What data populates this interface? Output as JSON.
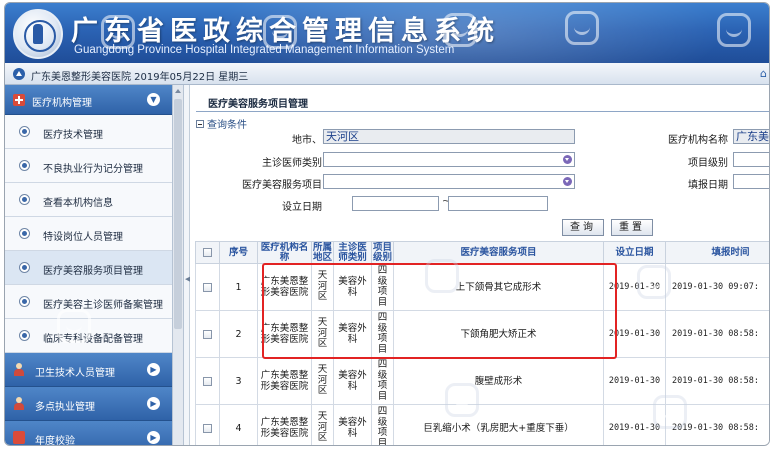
{
  "header": {
    "title": "广东省医政综合管理信息系统",
    "subtitle": "Guangdong Province Hospital Integrated Management Information System"
  },
  "infobar": {
    "text": "广东美恩整形美容医院 2019年05月22日 星期三"
  },
  "sidebar": {
    "section_label": "医疗机构管理",
    "items": [
      {
        "label": "医疗技术管理"
      },
      {
        "label": "不良执业行为记分管理"
      },
      {
        "label": "查看本机构信息"
      },
      {
        "label": "特设岗位人员管理"
      },
      {
        "label": "医疗美容服务项目管理"
      },
      {
        "label": "医疗美容主诊医师备案管理"
      },
      {
        "label": "临床专科设备配备管理"
      }
    ],
    "categories": [
      {
        "label": "卫生技术人员管理"
      },
      {
        "label": "多点执业管理"
      },
      {
        "label": "年度校验"
      }
    ]
  },
  "main": {
    "page_title": "医疗美容服务项目管理",
    "query_toggle": "查询条件",
    "form": {
      "city_label": "地市、区（县）",
      "city_value": "天河区",
      "org_label": "医疗机构名称",
      "org_value": "广东美",
      "doctor_type_label": "主诊医师类别",
      "doctor_type_value": "",
      "level_label": "项目级别",
      "service_label": "医疗美容服务项目",
      "service_value": "",
      "fill_date_label": "填报日期",
      "setup_date_label": "设立日期",
      "date_sep": "~",
      "search_button": "查询",
      "reset_button": "重置"
    },
    "table": {
      "headers": [
        "序号",
        "医疗机构名称",
        "所属地区",
        "主诊医师类别",
        "项目级别",
        "医疗美容服务项目",
        "设立日期",
        "填报时间"
      ],
      "rows": [
        {
          "no": "1",
          "org": "广东美恩整形美容医院",
          "region": "天河区",
          "doctor_type": "美容外科",
          "level": "四级项目",
          "service": "上下颌骨其它成形术",
          "setup_date": "2019-01-30",
          "fill_time": "2019-01-30 09:07:"
        },
        {
          "no": "2",
          "org": "广东美恩整形美容医院",
          "region": "天河区",
          "doctor_type": "美容外科",
          "level": "四级项目",
          "service": "下颌角肥大矫正术",
          "setup_date": "2019-01-30",
          "fill_time": "2019-01-30 08:58:"
        },
        {
          "no": "3",
          "org": "广东美恩整形美容医院",
          "region": "天河区",
          "doctor_type": "美容外科",
          "level": "四级项目",
          "service": "腹壁成形术",
          "setup_date": "2019-01-30",
          "fill_time": "2019-01-30 08:58:"
        },
        {
          "no": "4",
          "org": "广东美恩整形美容医院",
          "region": "天河区",
          "doctor_type": "美容外科",
          "level": "四级项目",
          "service": "巨乳缩小术（乳房肥大+重度下垂）",
          "setup_date": "2019-01-30",
          "fill_time": "2019-01-30 08:58:"
        }
      ]
    }
  },
  "colors": {
    "banner_blue": "#2b63b4",
    "sidebar_header_blue": "#2f62a8",
    "table_header_text": "#2c56a0",
    "highlight_red": "#e22323"
  }
}
